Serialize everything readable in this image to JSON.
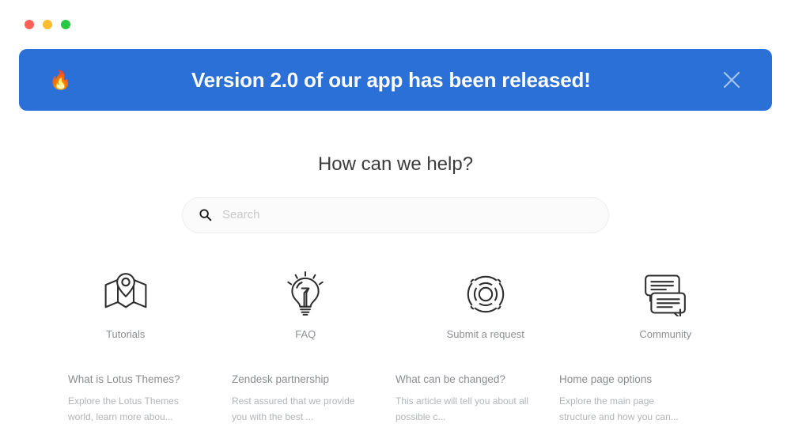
{
  "window": {
    "traffic_lights": [
      {
        "name": "close",
        "color": "#ff5f57"
      },
      {
        "name": "minimize",
        "color": "#febc2e"
      },
      {
        "name": "maximize",
        "color": "#28c840"
      }
    ]
  },
  "banner": {
    "emoji": "🔥",
    "emoji_name": "fire-emoji",
    "text": "Version 2.0 of our app has been released!",
    "close_label": "Close banner",
    "background_color": "#2b70d6",
    "text_color": "#ffffff",
    "close_icon_color": "#a8c6ec"
  },
  "hero": {
    "title": "How can we help?"
  },
  "search": {
    "placeholder": "Search",
    "value": "",
    "icon": "search-icon"
  },
  "categories": [
    {
      "label": "Tutorials",
      "icon": "map-pin-icon"
    },
    {
      "label": "FAQ",
      "icon": "lightbulb-icon"
    },
    {
      "label": "Submit a request",
      "icon": "lifebuoy-icon"
    },
    {
      "label": "Community",
      "icon": "speech-bubbles-icon"
    }
  ],
  "articles": [
    {
      "title": "What is Lotus Themes?",
      "description": "Explore the Lotus Themes world, learn more abou..."
    },
    {
      "title": "Zendesk partnership",
      "description": "Rest assured that we provide you with the best ..."
    },
    {
      "title": "What can be changed?",
      "description": "This article will tell you about all possible c..."
    },
    {
      "title": "Home page options",
      "description": "Explore the main page structure and how you can..."
    }
  ]
}
